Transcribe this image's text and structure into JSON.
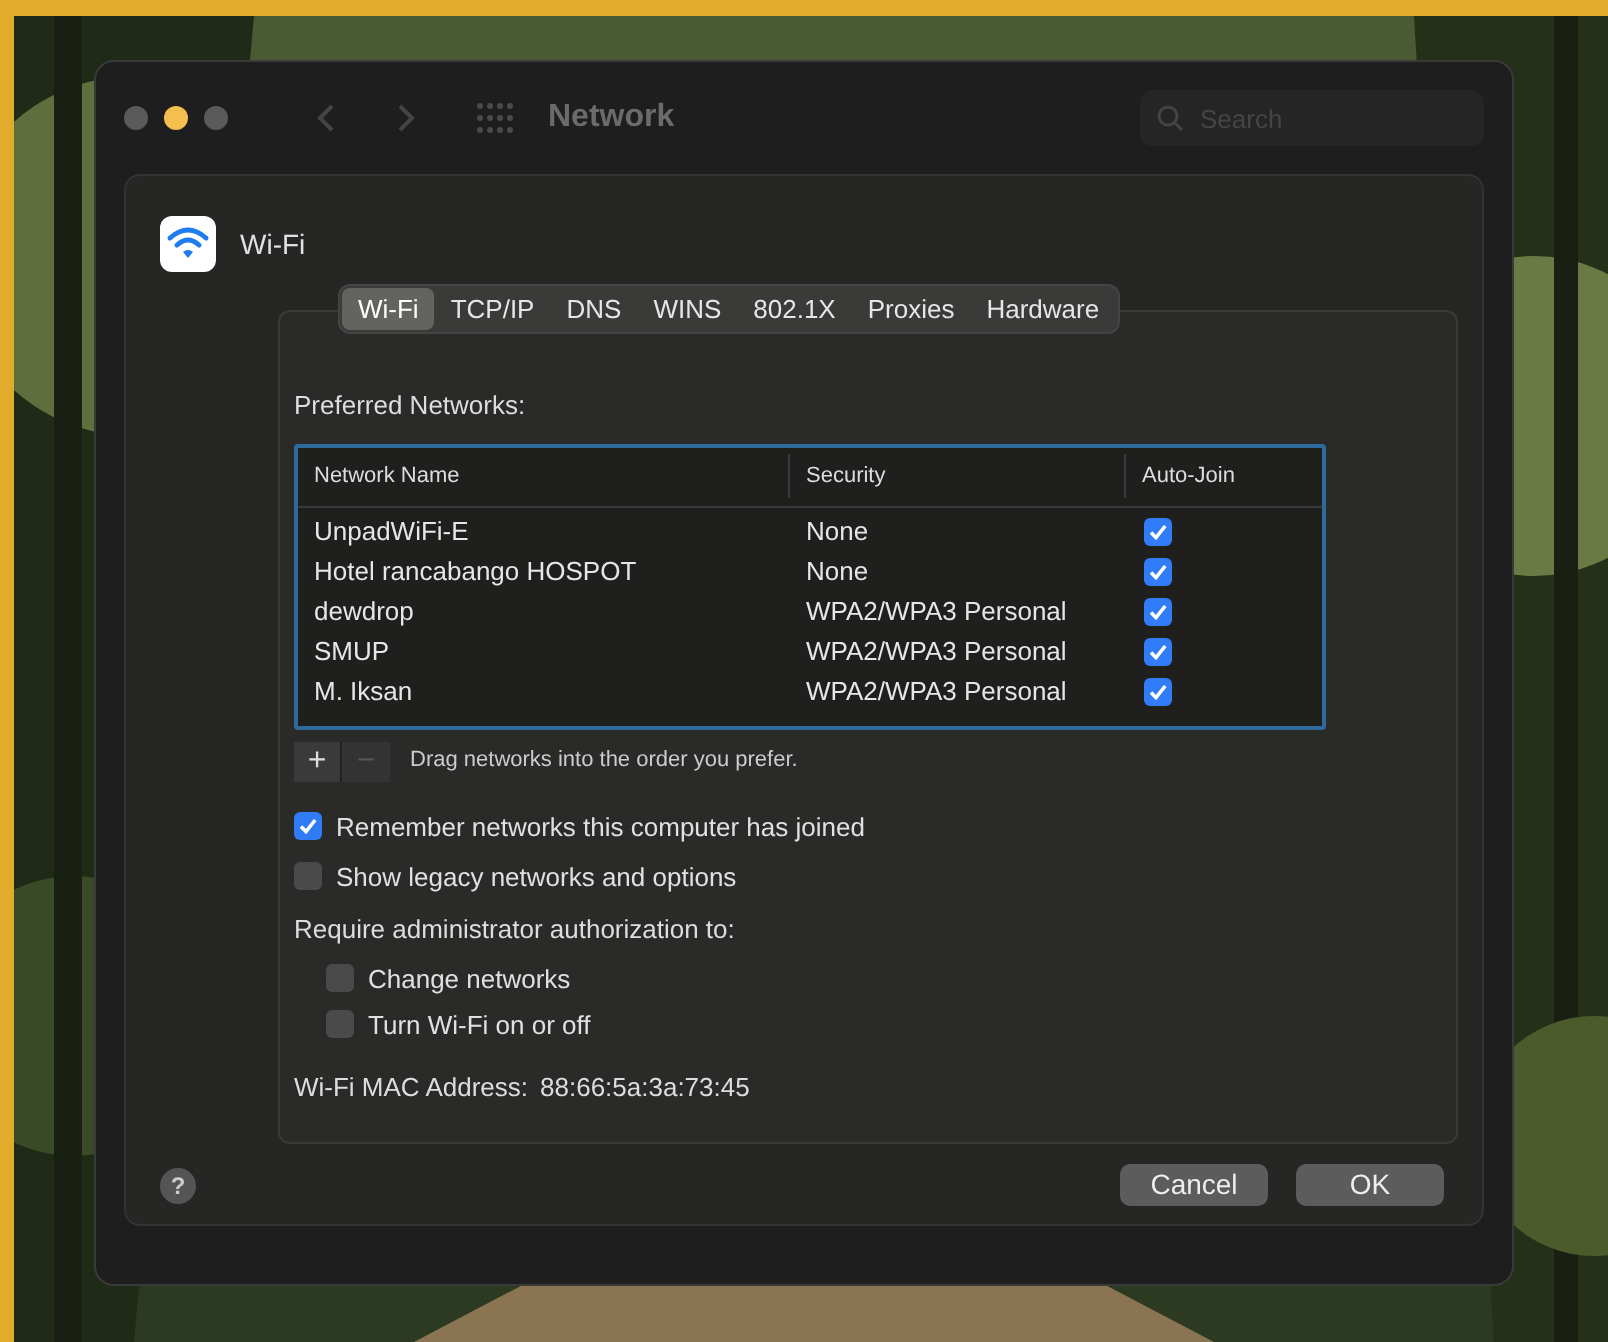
{
  "window": {
    "title": "Network",
    "search": {
      "placeholder": "Search"
    },
    "traffic_lights": [
      {
        "color": "#5a5a5a"
      },
      {
        "color": "#f4bf4f"
      },
      {
        "color": "#5a5a5a"
      }
    ]
  },
  "service": {
    "name": "Wi-Fi"
  },
  "tabs": [
    {
      "label": "Wi-Fi",
      "selected": true
    },
    {
      "label": "TCP/IP",
      "selected": false
    },
    {
      "label": "DNS",
      "selected": false
    },
    {
      "label": "WINS",
      "selected": false
    },
    {
      "label": "802.1X",
      "selected": false
    },
    {
      "label": "Proxies",
      "selected": false
    },
    {
      "label": "Hardware",
      "selected": false
    }
  ],
  "preferred_networks": {
    "label": "Preferred Networks:",
    "columns": [
      "Network Name",
      "Security",
      "Auto-Join"
    ],
    "rows": [
      {
        "name": "UnpadWiFi-E",
        "security": "None",
        "auto_join": true
      },
      {
        "name": "Hotel rancabango HOSPOT",
        "security": "None",
        "auto_join": true
      },
      {
        "name": "dewdrop",
        "security": "WPA2/WPA3 Personal",
        "auto_join": true
      },
      {
        "name": "SMUP",
        "security": "WPA2/WPA3 Personal",
        "auto_join": true
      },
      {
        "name": "M. Iksan",
        "security": "WPA2/WPA3 Personal",
        "auto_join": true
      }
    ],
    "add": "+",
    "remove": "−",
    "hint": "Drag networks into the order you prefer."
  },
  "options": [
    {
      "label": "Remember networks this computer has joined",
      "checked": true
    },
    {
      "label": "Show legacy networks and options",
      "checked": false
    }
  ],
  "admin": {
    "label": "Require administrator authorization to:",
    "options": [
      {
        "label": "Change networks",
        "checked": false
      },
      {
        "label": "Turn Wi-Fi on or off",
        "checked": false
      }
    ]
  },
  "mac": {
    "label": "Wi-Fi MAC Address:",
    "value": "88:66:5a:3a:73:45"
  },
  "help": "?",
  "buttons": [
    {
      "label": "Cancel"
    },
    {
      "label": "OK"
    }
  ]
}
